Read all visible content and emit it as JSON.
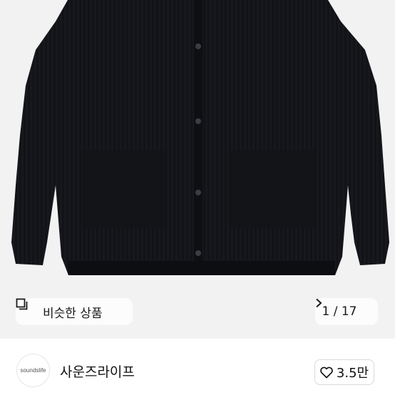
{
  "product_image": {
    "alt_icon": "knit-cardigan-photo",
    "background_color": "#f2f2f2",
    "garment_color": "#0f1115"
  },
  "similar_button": {
    "icon": "similar-items-icon",
    "label": "비슷한 상품"
  },
  "image_counter": {
    "text": "1 / 17",
    "icon": "chevron-right-icon"
  },
  "seller": {
    "avatar_text": "soundslife",
    "name": "사운즈라이프"
  },
  "like": {
    "icon": "heart-outline-icon",
    "count": "3.5만"
  }
}
